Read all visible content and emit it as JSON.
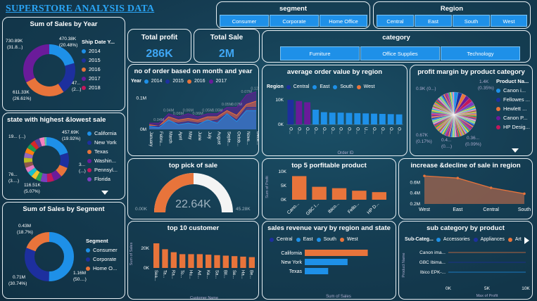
{
  "header": {
    "title": "SUPERSTORE ANALYSIS DATA"
  },
  "colors": {
    "blue": "#1e90e8",
    "navy": "#1d2f9e",
    "orange": "#e8743b",
    "purple": "#6a1b9a",
    "magenta": "#c2185b",
    "panel_border": "#e6eef2"
  },
  "slicers": {
    "segment": {
      "title": "segment",
      "options": [
        "Consumer",
        "Corporate",
        "Home Office"
      ]
    },
    "region": {
      "title": "Region",
      "options": [
        "Central",
        "East",
        "South",
        "West"
      ]
    },
    "category": {
      "title": "category",
      "options": [
        "Furniture",
        "Office Supplies",
        "Technology"
      ]
    }
  },
  "kpis": {
    "profit": {
      "label": "Total profit",
      "value": "286K"
    },
    "sale": {
      "label": "Total Sale",
      "value": "2M"
    }
  },
  "sales_by_year": {
    "title": "Sum of Sales by Year",
    "legend_title": "Ship Date Y...",
    "items": [
      {
        "name": "2014",
        "color": "#1e90e8"
      },
      {
        "name": "2015",
        "color": "#1d2f9e"
      },
      {
        "name": "2016",
        "color": "#e8743b"
      },
      {
        "name": "2017",
        "color": "#6a1b9a"
      },
      {
        "name": "2018",
        "color": "#c2185b"
      }
    ],
    "labels": {
      "a": "730.89K",
      "a2": "(31.8...)",
      "b": "470.38K",
      "b2": "(20.48%)",
      "c": "611.33K",
      "c2": "(26.61%)",
      "d": "47...",
      "d2": "(2...)"
    }
  },
  "state_sale": {
    "title": "state with highest &lowest sale",
    "items": [
      {
        "name": "California",
        "color": "#1e90e8"
      },
      {
        "name": "New York",
        "color": "#1d2f9e"
      },
      {
        "name": "Texas",
        "color": "#e8743b"
      },
      {
        "name": "Washin...",
        "color": "#6a1b9a"
      },
      {
        "name": "Pennsyl...",
        "color": "#c2185b"
      },
      {
        "name": "Florida",
        "color": "#7b3fbf"
      }
    ],
    "labels": {
      "a": "457.69K",
      "a2": "(19.92%)",
      "b": "19... (...)",
      "c": "3...",
      "c2": "(...)",
      "d": "76...",
      "d2": "(3....)",
      "e": "116.51K",
      "e2": "(5.07%)"
    }
  },
  "sales_by_segment": {
    "title": "Sum of Sales by Segment",
    "legend_title": "Segment",
    "items": [
      {
        "name": "Consumer",
        "color": "#1e90e8"
      },
      {
        "name": "Corporate",
        "color": "#1d2f9e"
      },
      {
        "name": "Home O...",
        "color": "#e8743b"
      }
    ],
    "labels": {
      "a": "0.43M",
      "a2": "(18.7%)",
      "b": "0.71M",
      "b2": "(30.74%)",
      "c": "1.16M",
      "c2": "(50....)"
    }
  },
  "orders_month": {
    "title": "no of order based on month and year",
    "legend_title": "Year",
    "series": [
      "2014",
      "2015",
      "2016",
      "2017"
    ],
    "series_colors": [
      "#1e90e8",
      "#1d2f9e",
      "#e8743b",
      "#6a1b9a"
    ],
    "months": [
      "January",
      "Febru...",
      "March",
      "April",
      "May",
      "June",
      "July",
      "August",
      "Septe...",
      "Octob...",
      "Nove...",
      "Dece..."
    ],
    "y_ticks": [
      "0M",
      "0.1M"
    ],
    "point_labels": [
      "0.04M",
      "0.04M",
      "0.06M",
      "0.06M",
      "0.06M",
      "0.05M",
      "0.05M",
      "0.05M",
      "0.07M",
      "0.07M",
      "0.12M"
    ]
  },
  "chart_data": [
    {
      "type": "bar",
      "title": "average order value by region",
      "legend_title": "Region",
      "series_names": [
        "Central",
        "East",
        "South",
        "West"
      ],
      "categories": [
        "O...",
        "O...",
        "O...",
        "O...",
        "O...",
        "O...",
        "O...",
        "O...",
        "O...",
        "U...",
        "O...",
        "O...",
        "O...",
        "O..."
      ],
      "values": [
        10000,
        9500,
        9000,
        6000,
        5000,
        4800,
        4800,
        4700,
        4600,
        4500,
        4400,
        4300,
        4200,
        4100
      ],
      "colors": [
        "#1d2f9e",
        "#6a1b9a",
        "#6a1b9a",
        "#1e90e8",
        "#1e90e8",
        "#1e90e8",
        "#1e90e8",
        "#1e90e8",
        "#1e90e8",
        "#1e90e8",
        "#1e90e8",
        "#1e90e8",
        "#1e90e8",
        "#1e90e8"
      ],
      "y_ticks": [
        "0K",
        "10K"
      ],
      "ylim": [
        0,
        12000
      ],
      "xlabel": "Order ID"
    },
    {
      "type": "bar",
      "title": "top 10 customer",
      "categories": [
        "Sea...",
        "Ta...",
        "Ra...",
        "To...",
        "Hu...",
        "Ad...",
        "Ke...",
        "Sa...",
        "Bil...",
        "Se...",
        "Ha...",
        "Be..."
      ],
      "values": [
        25000,
        19000,
        16000,
        14000,
        14000,
        14000,
        13500,
        13000,
        12500,
        12000,
        11500,
        11000
      ],
      "y_ticks": [
        "0K",
        "20K"
      ],
      "ylim": [
        0,
        30000
      ],
      "xlabel": "Customer Name",
      "ylabel": "Sum of Sales"
    },
    {
      "type": "bar",
      "title": "top 5 porfitable product",
      "categories": [
        "Cano...",
        "GBC I...",
        "Ibico...",
        "Fello...",
        "HP D..."
      ],
      "values": [
        8400,
        4600,
        4100,
        3200,
        2700
      ],
      "y_ticks": [
        "0K",
        "5K",
        "10K"
      ],
      "ylim": [
        0,
        10000
      ],
      "ylabel": "Sum of Profit"
    },
    {
      "type": "area",
      "title": "increase &decline of sale in region",
      "categories": [
        "West",
        "East",
        "Central",
        "South"
      ],
      "values": [
        0.72,
        0.68,
        0.5,
        0.39
      ],
      "y_ticks": [
        "0.2M",
        "0.4M",
        "0.6M"
      ],
      "ylim": [
        0.2,
        0.8
      ]
    },
    {
      "type": "bar",
      "title": "sales revenue vary by region and state",
      "legend_items": [
        "Central",
        "East",
        "South",
        "West"
      ],
      "categories": [
        "California",
        "New York",
        "Texas"
      ],
      "values": [
        457.69,
        310.88,
        170.19
      ],
      "colors": [
        "#e8743b",
        "#1e90e8",
        "#1e90e8"
      ],
      "xlabel": "Sum of Sales"
    },
    {
      "type": "scatter",
      "title": "sub category by product",
      "legend_title": "Sub-Categ...",
      "legend_items": [
        "Accessories",
        "Appliances",
        "Art"
      ],
      "categories": [
        "Canon ima...",
        "GBC Ibima...",
        "Ibico EPK-..."
      ],
      "x_ticks": [
        "0K",
        "5K",
        "10K"
      ],
      "xlabel": "Max of Profit",
      "ylabel": "Product Name"
    },
    {
      "type": "pie",
      "title": "profit margin by product category",
      "legend_title": "Product Na...",
      "legend_items": [
        "Canon i...",
        "Fellowes ...",
        "Hewlett ...",
        "Canon P...",
        "HP Desig..."
      ],
      "legend_colors": [
        "#1e90e8",
        "#1d2f9e",
        "#e8743b",
        "#6a1b9a",
        "#c2185b"
      ],
      "labels": [
        "0.9K (0...)",
        "0.67K",
        "(0.17%)",
        "0.4...",
        "(0....)",
        "0.36...",
        "(0.09%)",
        "1.4K",
        "(0.35%)"
      ]
    },
    {
      "type": "pie",
      "title": "top pick of sale",
      "value_label": "22.64K",
      "min_label": "0.00K",
      "max_label": "45.28K",
      "value": 22.64,
      "max": 45.28
    }
  ]
}
